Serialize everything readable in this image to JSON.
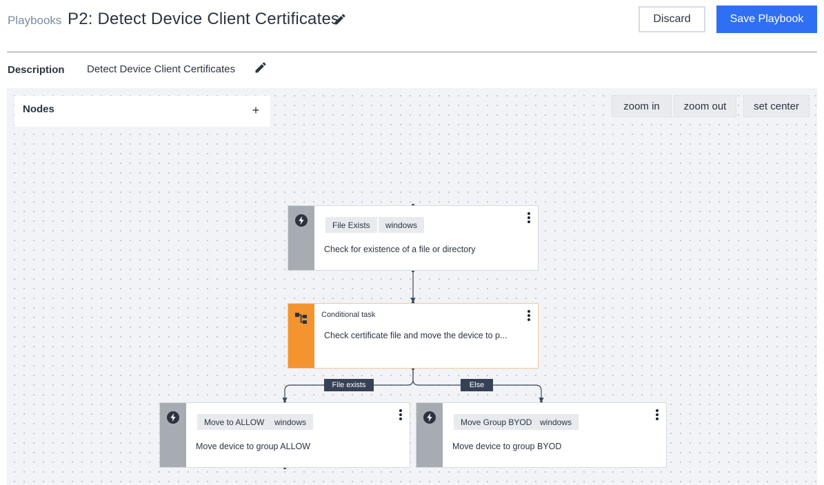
{
  "header": {
    "breadcrumb": "Playbooks",
    "title": "P2: Detect Device Client Certificates",
    "edit_icon": "pencil-icon",
    "discard_label": "Discard",
    "save_label": "Save Playbook"
  },
  "description": {
    "label": "Description",
    "text": "Detect Device Client Certificates"
  },
  "canvas": {
    "nodes_panel": {
      "title": "Nodes",
      "add_label": "+"
    },
    "zoom_in": "zoom in",
    "zoom_out": "zoom out",
    "set_center": "set center"
  },
  "nodes": [
    {
      "kind": "action",
      "icon": "lightning-icon",
      "tags": [
        "File Exists",
        "windows"
      ],
      "description": "Check for existence of a file or directory"
    },
    {
      "kind": "conditional",
      "icon": "flow-icon",
      "type_label": "Conditional task",
      "description": "Check certificate file and move the device to p..."
    },
    {
      "kind": "action",
      "icon": "lightning-icon",
      "tags": [
        "Move to ALLOW",
        "windows"
      ],
      "description": "Move device to group ALLOW"
    },
    {
      "kind": "action",
      "icon": "lightning-icon",
      "tags": [
        "Move Group BYOD",
        "windows"
      ],
      "description": "Move device to group BYOD"
    }
  ],
  "edge_labels": [
    "File exists",
    "Else"
  ],
  "colors": {
    "primary": "#2f6ff3",
    "conditional": "#f3942f",
    "action_stripe": "#a7acb3",
    "edge_label_bg": "#364156"
  }
}
